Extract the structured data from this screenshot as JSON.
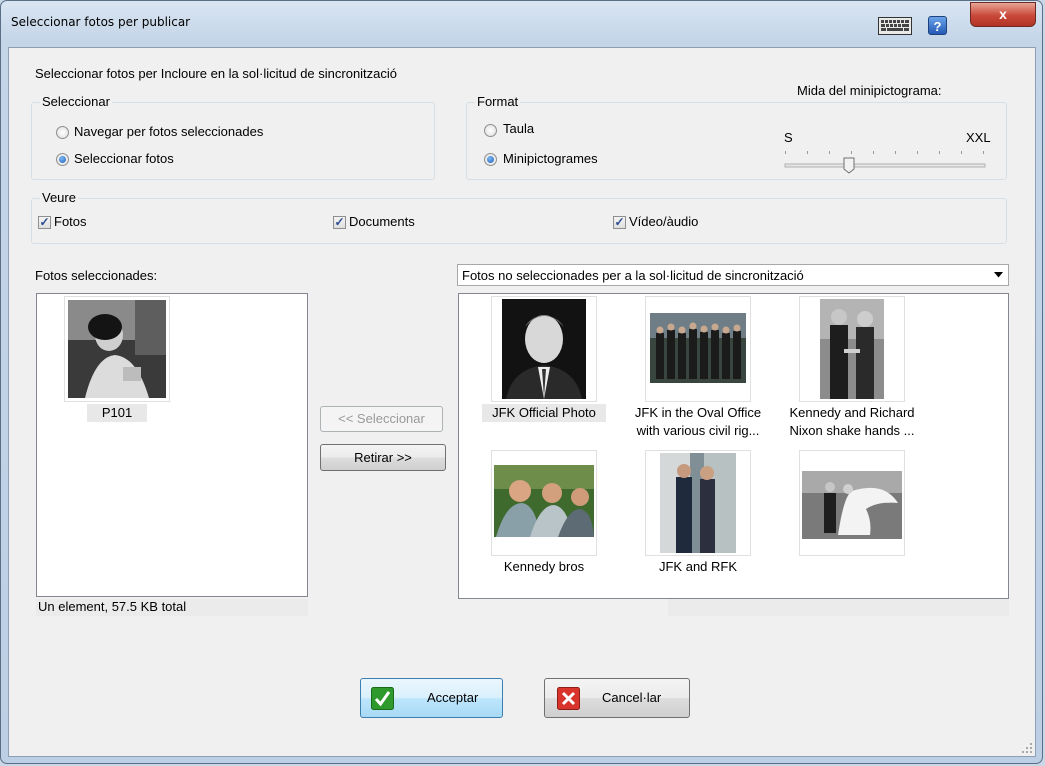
{
  "window": {
    "title": "Seleccionar fotos per publicar",
    "close_glyph": "x",
    "help_glyph": "?",
    "icons": [
      "keyboard-icon",
      "help-icon",
      "close-icon"
    ]
  },
  "instruction": "Seleccionar fotos per Incloure en la sol·licitud de sincronització",
  "select_group": {
    "legend": "Seleccionar",
    "options": [
      "Navegar per fotos seleccionades",
      "Seleccionar fotos"
    ],
    "selected": 1
  },
  "format_group": {
    "legend": "Format",
    "options": [
      "Taula",
      "Minipictogrames"
    ],
    "selected": 1,
    "slider": {
      "label": "Mida del minipictograma:",
      "min_label": "S",
      "max_label": "XXL",
      "value_fraction": 0.43
    }
  },
  "view_group": {
    "legend": "Veure",
    "checks": [
      {
        "label": "Fotos",
        "checked": true
      },
      {
        "label": "Documents",
        "checked": true
      },
      {
        "label": "Vídeo/àudio",
        "checked": true
      }
    ],
    "check_glyph": "✓"
  },
  "selected_panel": {
    "label": "Fotos seleccionades:",
    "items": [
      {
        "caption": "P101"
      }
    ],
    "status": "Un element, 57.5 KB total"
  },
  "buttons": {
    "select": "<< Seleccionar",
    "remove": "Retirar >>",
    "accept": "Acceptar",
    "cancel": "Cancel·lar"
  },
  "unselected_panel": {
    "dropdown": "Fotos no seleccionades per a la sol·licitud de sincronització",
    "items": [
      {
        "caption1": "JFK Official Photo",
        "caption2": ""
      },
      {
        "caption1": "JFK in the Oval Office",
        "caption2": "with various civil rig..."
      },
      {
        "caption1": "Kennedy and Richard",
        "caption2": "Nixon shake hands ..."
      },
      {
        "caption1": "Kennedy bros",
        "caption2": ""
      },
      {
        "caption1": "JFK and RFK",
        "caption2": ""
      },
      {
        "caption1": "",
        "caption2": ""
      }
    ]
  },
  "colors": {
    "accept_icon": "#2e9a2e",
    "cancel_icon": "#d9342b",
    "selection_highlight": "#e8e8e8"
  }
}
